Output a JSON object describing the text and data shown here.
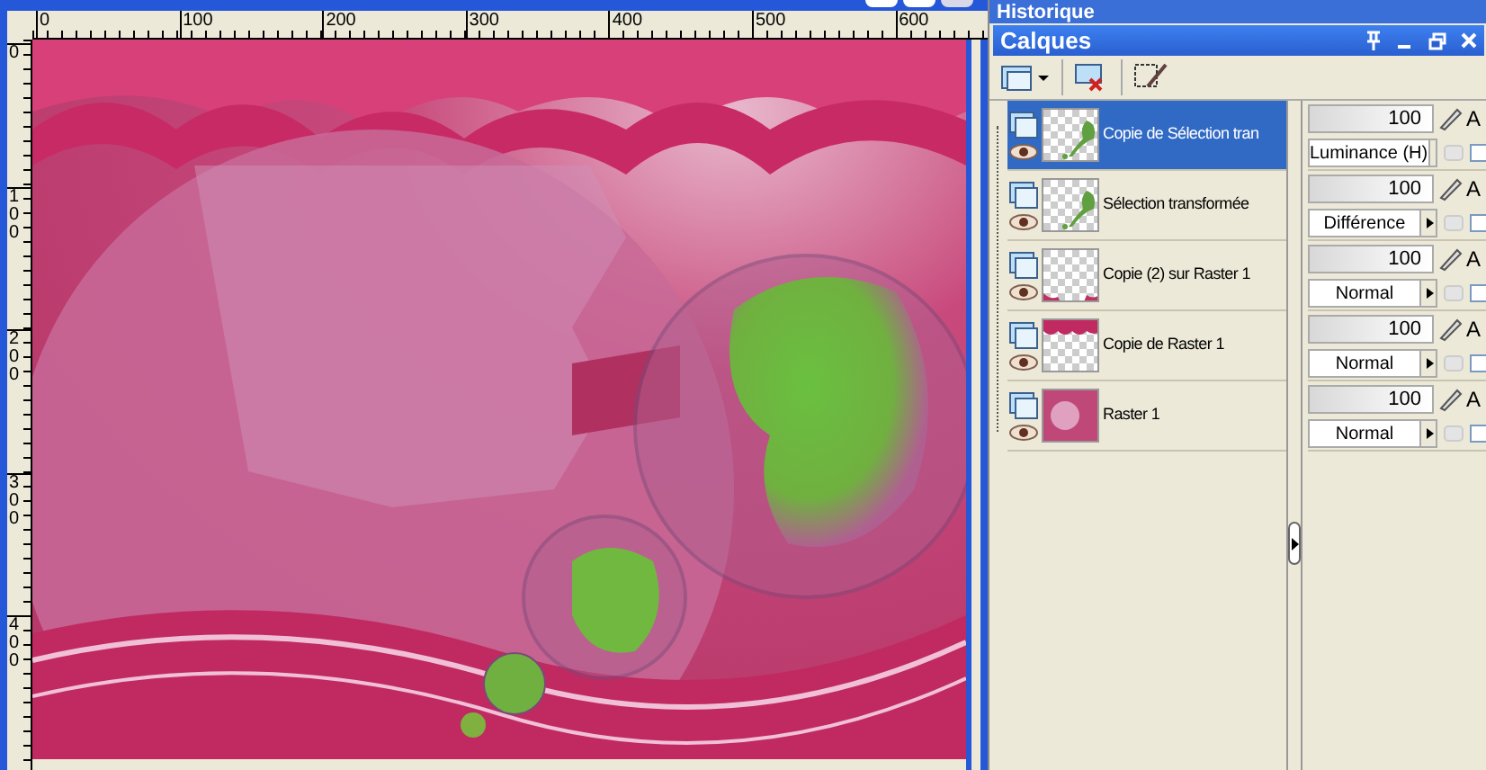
{
  "rulers": {
    "horizontal": [
      "0",
      "100",
      "200",
      "300",
      "400",
      "500",
      "600"
    ],
    "vertical": [
      "0",
      "100",
      "200",
      "300",
      "400"
    ]
  },
  "history_panel": {
    "title": "Historique"
  },
  "layers_panel": {
    "title": "Calques",
    "layers": [
      {
        "name": "Copie de Sélection tran",
        "selected": true,
        "kind": "leaf",
        "opacity": "100",
        "blend_mode": "Luminance (H)",
        "lock_label": "A",
        "checked": false
      },
      {
        "name": "Sélection transformée",
        "selected": false,
        "kind": "leaf",
        "opacity": "100",
        "blend_mode": "Différence",
        "lock_label": "A",
        "checked": false
      },
      {
        "name": "Copie (2) sur Raster 1",
        "selected": false,
        "kind": "bottom-edge",
        "opacity": "100",
        "blend_mode": "Normal",
        "lock_label": "A",
        "checked": false
      },
      {
        "name": "Copie de Raster 1",
        "selected": false,
        "kind": "top-edge",
        "opacity": "100",
        "blend_mode": "Normal",
        "lock_label": "A",
        "checked": false
      },
      {
        "name": "Raster 1",
        "selected": false,
        "kind": "pink",
        "opacity": "100",
        "blend_mode": "Normal",
        "lock_label": "A",
        "checked": false
      }
    ]
  }
}
